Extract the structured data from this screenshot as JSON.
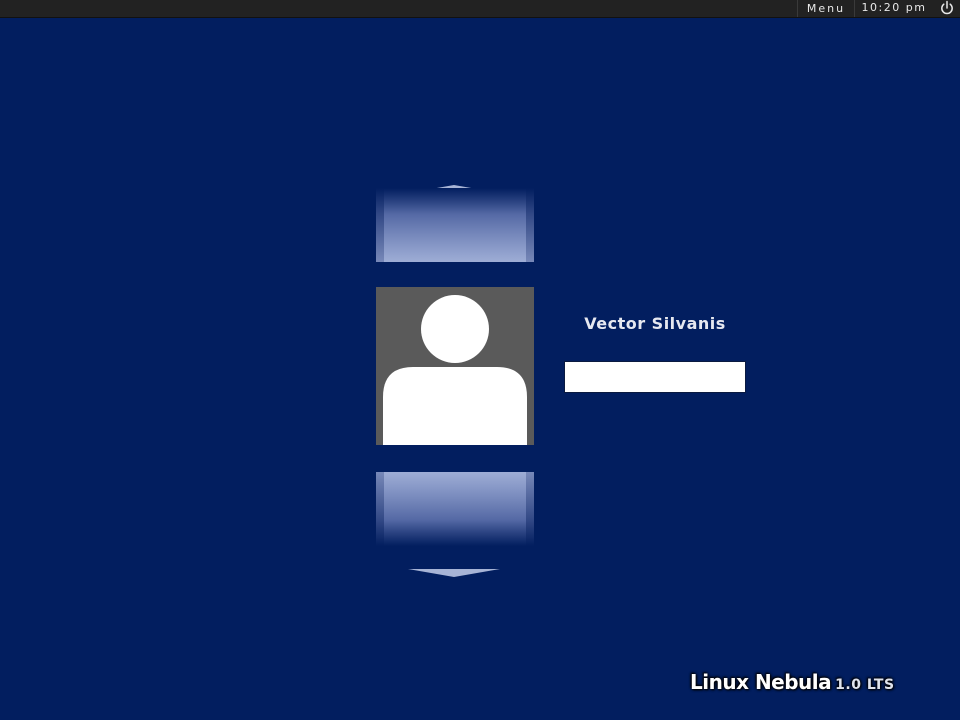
{
  "top_bar": {
    "menu_label": "Menu",
    "clock": "10:20 pm",
    "power_icon": "power-icon"
  },
  "login": {
    "user_name": "Vector Silvanis",
    "password_value": "",
    "password_placeholder": "",
    "avatar_icon": "user-silhouette-icon",
    "previous_user_icon": "chevron-up-icon",
    "next_user_icon": "chevron-down-icon"
  },
  "branding": {
    "name": "Linux Nebula",
    "version": "1.0 LTS"
  },
  "colors": {
    "background": "#021e5f",
    "top_bar": "#222222",
    "avatar_background": "#5a5a5a",
    "avatar_figure": "#ffffff",
    "text": "#e6e8f0"
  }
}
